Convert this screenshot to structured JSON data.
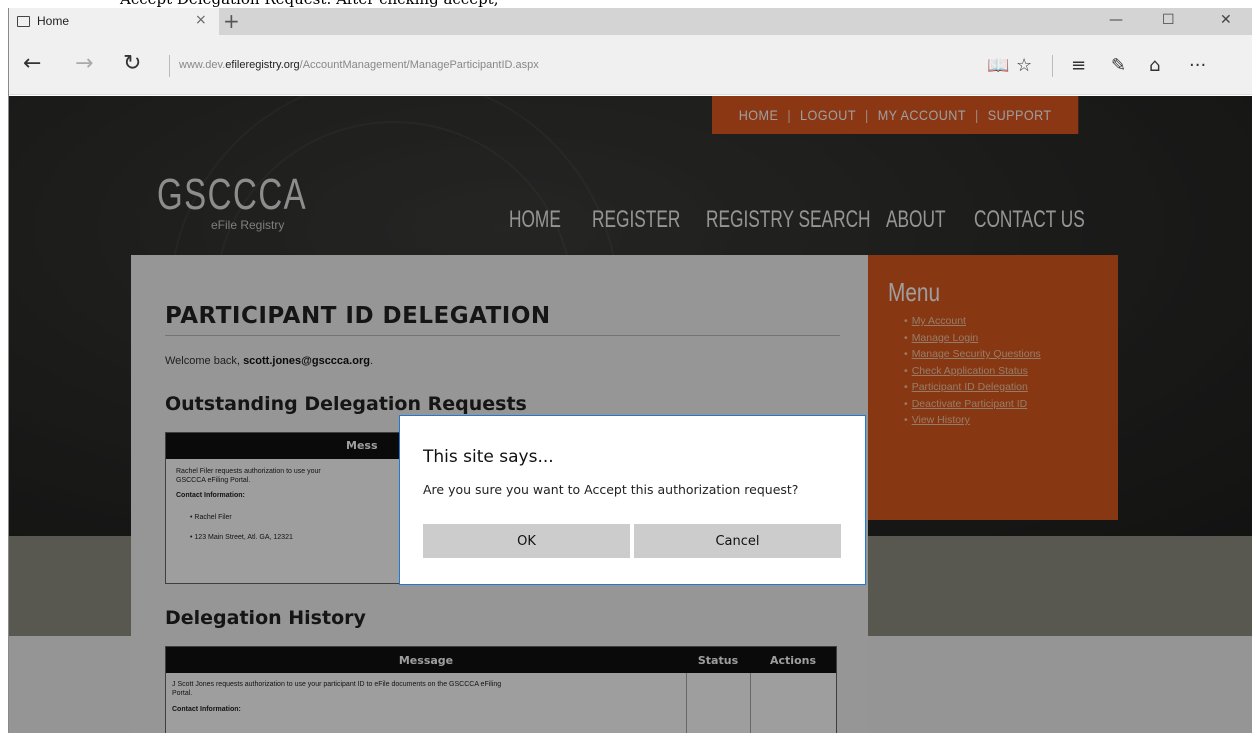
{
  "doc_heading": "Accept Delegation Request: After clicking accept,",
  "browser": {
    "tab_title": "Home",
    "tab_close": "×",
    "new_tab": "+",
    "window_controls": [
      "—",
      "☐",
      "✕"
    ],
    "back": "←",
    "forward": "→",
    "refresh": "↻",
    "url_prefix": "www.dev.",
    "url_domain": "efileregistry.org",
    "url_path": "/AccountManagement/ManageParticipantID.aspx",
    "tools": [
      "📖",
      "☆",
      "≡",
      "✎",
      "⌂",
      "···"
    ]
  },
  "site": {
    "top_nav": [
      "HOME",
      "LOGOUT",
      "MY ACCOUNT",
      "SUPPORT"
    ],
    "top_nav_sep": "|",
    "logo_main": "GSCCCA",
    "logo_sub": "eFile Registry",
    "main_nav": [
      "HOME",
      "REGISTER",
      "REGISTRY SEARCH",
      "ABOUT",
      "CONTACT US"
    ],
    "accent_color": "#e0591f"
  },
  "content": {
    "title": "PARTICIPANT ID DELEGATION",
    "welcome_prefix": "Welcome back,",
    "welcome_email": "scott.jones@gsccca.org",
    "welcome_suffix": ".",
    "outstanding_heading": "Outstanding Delegation Requests",
    "outstanding_col": "Mess",
    "outstanding_text1": "Rachel Filer requests authorization to use your",
    "outstanding_text2": "GSCCCA eFiling Portal.",
    "contact_label": "Contact Information:",
    "contact_name": "Rachel Filer",
    "contact_address": "123 Main Street, Atl. GA, 12321",
    "history_heading": "Delegation History",
    "history_cols": [
      "Message",
      "Status",
      "Actions"
    ],
    "history_text1": "J Scott Jones requests authorization to use your participant ID to eFile documents on the GSCCCA eFiling",
    "history_text2": "Portal.",
    "history_contact_label": "Contact Information:"
  },
  "menu": {
    "title": "Menu",
    "items": [
      "My Account",
      "Manage Login",
      "Manage Security Questions",
      "Check Application Status",
      "Participant ID Delegation",
      "Deactivate Participant ID",
      "View History"
    ]
  },
  "dialog": {
    "title": "This site says...",
    "message": "Are you sure you want to Accept this authorization request?",
    "ok_label": "OK",
    "cancel_label": "Cancel"
  }
}
